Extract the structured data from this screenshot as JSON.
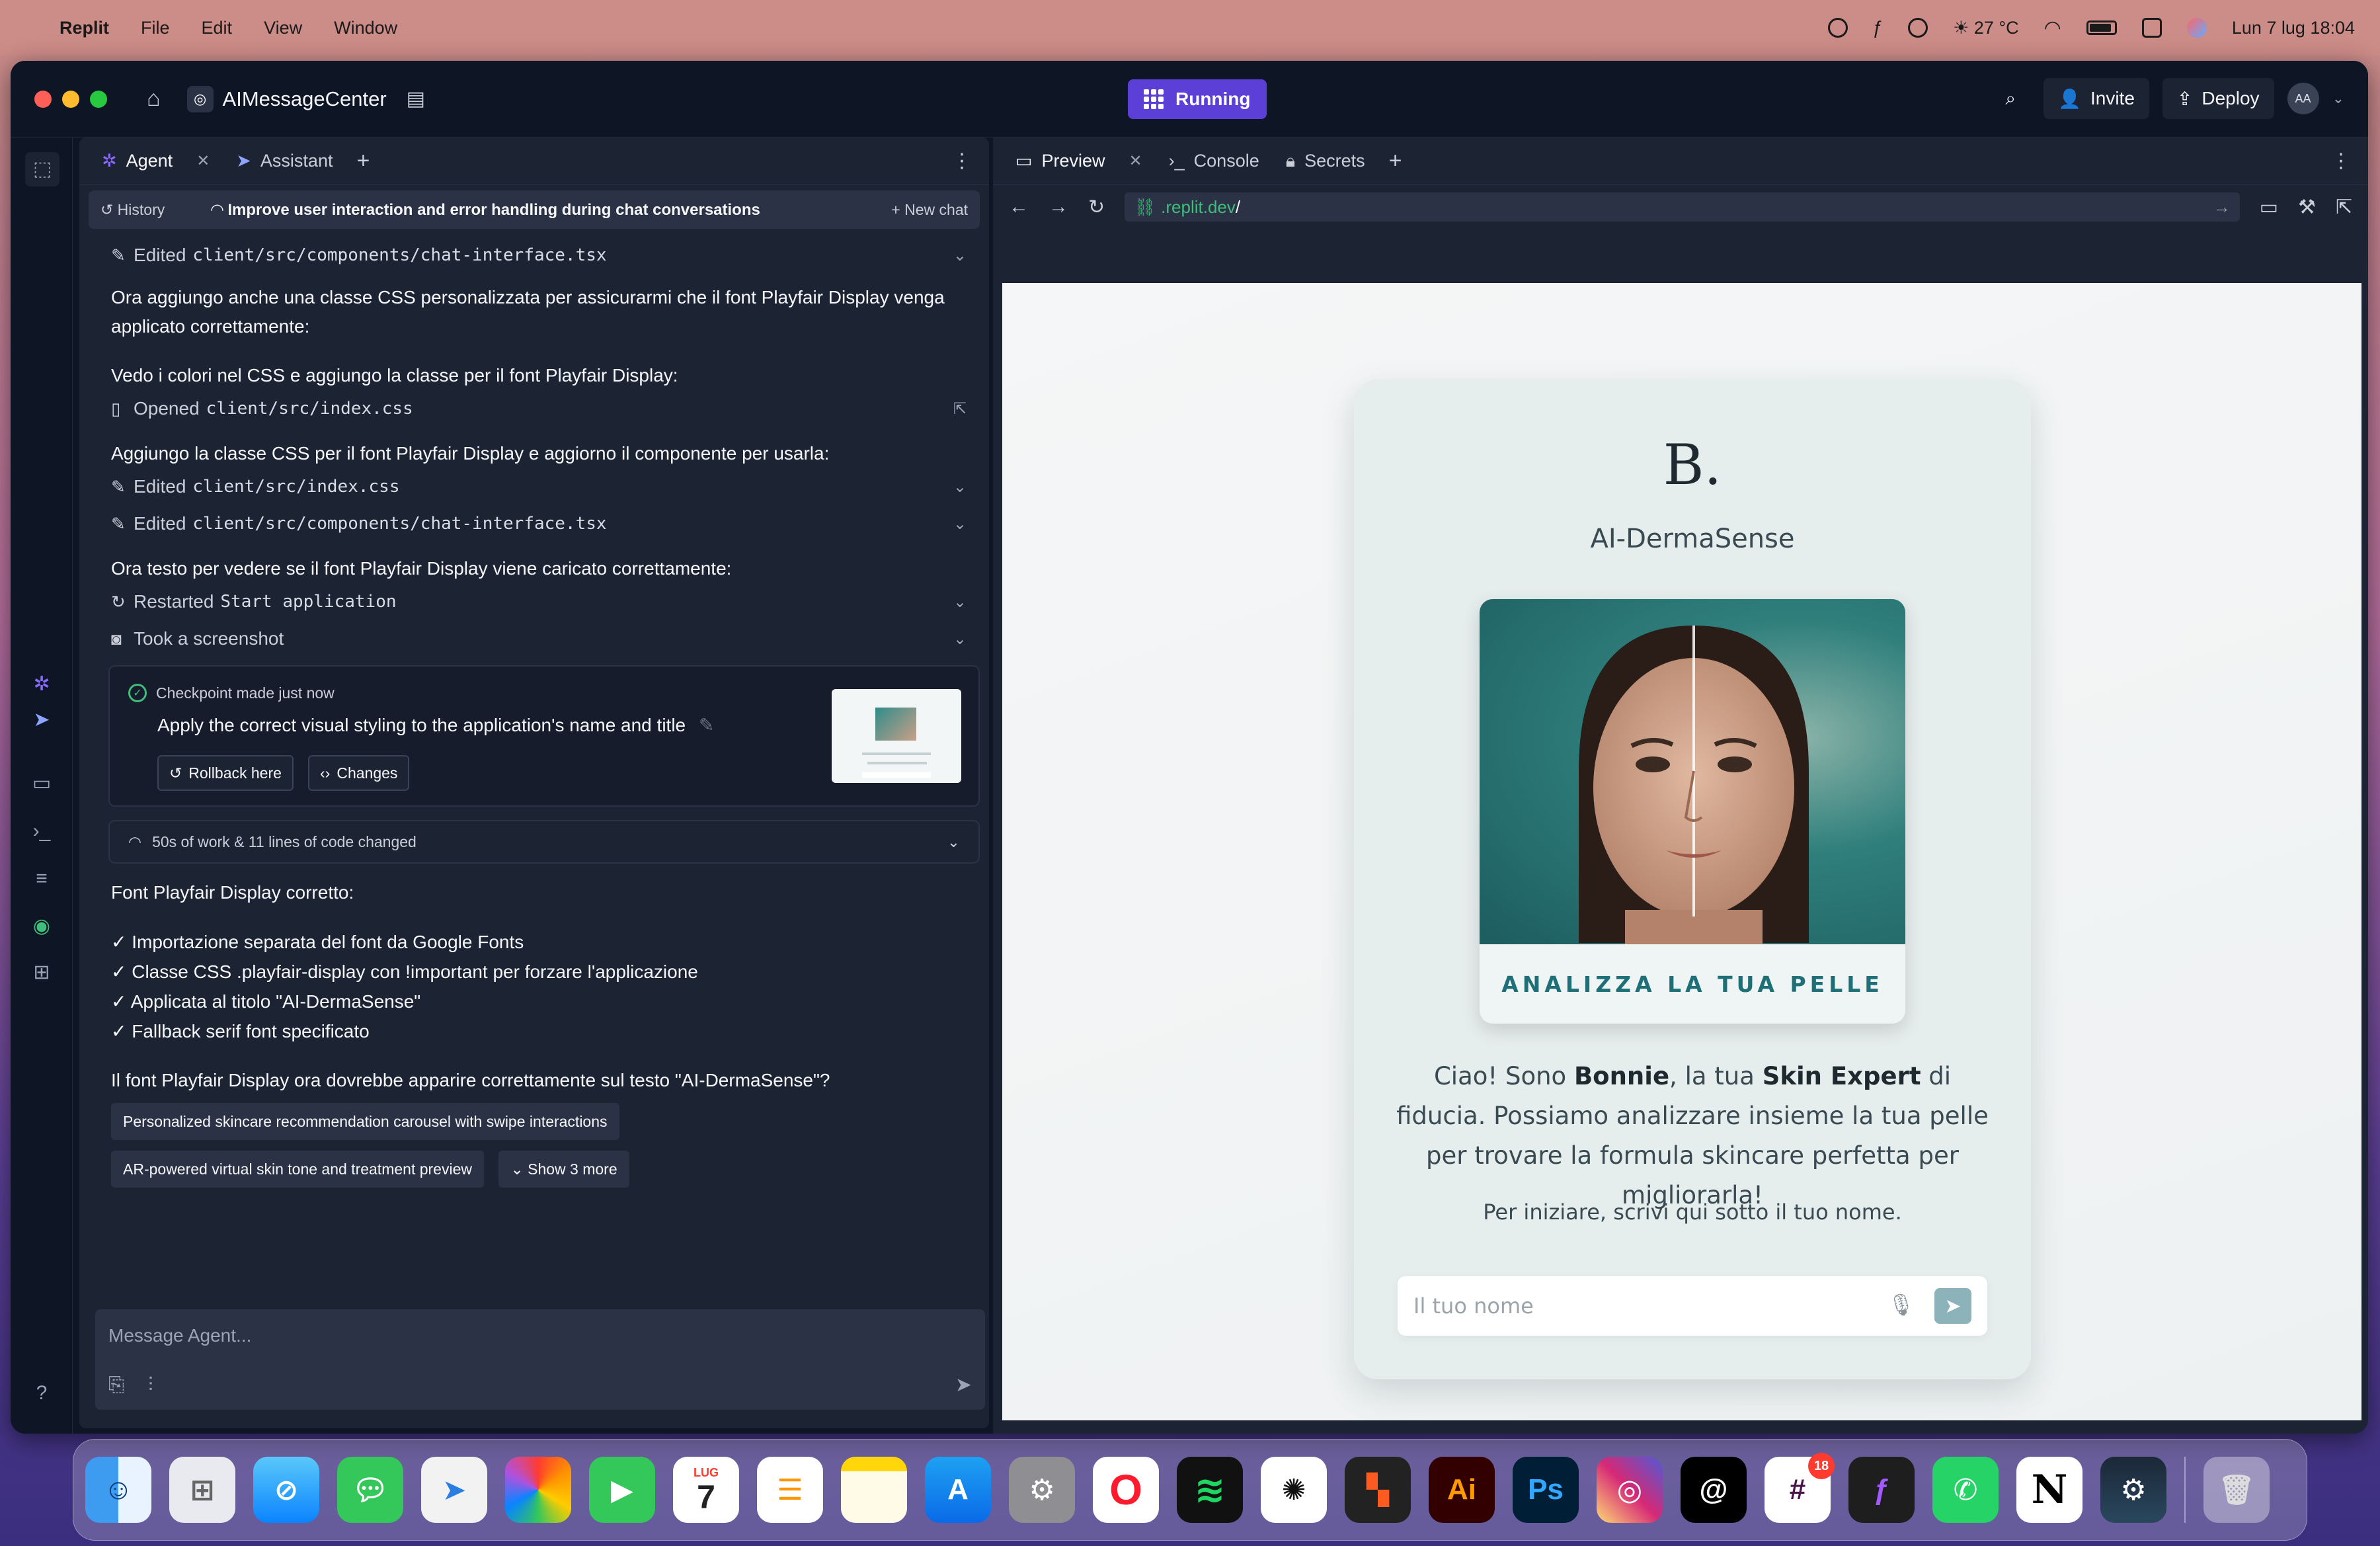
{
  "menubar": {
    "app": "Replit",
    "items": [
      "File",
      "Edit",
      "View",
      "Window"
    ],
    "weather": "27 °C",
    "datetime": "Lun 7 lug  18:04"
  },
  "window": {
    "repl_name": "AIMessageCenter",
    "status": "Running",
    "invite_label": "Invite",
    "deploy_label": "Deploy",
    "avatar_initials": "AA"
  },
  "agent": {
    "tabs": [
      {
        "label": "Agent"
      },
      {
        "label": "Assistant"
      }
    ],
    "history_label": "History",
    "chat_title": "Improve user interaction and error handling during chat conversations",
    "new_chat_label": "New chat",
    "entries": {
      "a1": {
        "verb": "Edited",
        "path": "client/src/components/chat-interface.tsx"
      },
      "m1": "Ora aggiungo anche una classe CSS personalizzata per assicurarmi che il font Playfair Display venga applicato correttamente:",
      "m2": "Vedo i colori nel CSS e aggiungo la classe per il font Playfair Display:",
      "a2": {
        "verb": "Opened",
        "path": "client/src/index.css"
      },
      "m3": "Aggiungo la classe CSS per il font Playfair Display e aggiorno il componente per usarla:",
      "a3": {
        "verb": "Edited",
        "path": "client/src/index.css"
      },
      "a4": {
        "verb": "Edited",
        "path": "client/src/components/chat-interface.tsx"
      },
      "m4": "Ora testo per vedere se il font Playfair Display viene caricato correttamente:",
      "a5": {
        "verb": "Restarted",
        "path": "Start application"
      },
      "a6": {
        "verb": "Took a screenshot"
      }
    },
    "checkpoint": {
      "status": "Checkpoint made just now",
      "title": "Apply the correct visual styling to the application's name and title",
      "rollback_label": "Rollback here",
      "changes_label": "Changes"
    },
    "work_summary": "50s of work & 11 lines of code changed",
    "result_heading": "Font Playfair Display corretto:",
    "checklist": [
      "✓ Importazione separata del font da Google Fonts",
      "✓ Classe CSS .playfair-display con !important per forzare l'applicazione",
      "✓ Applicata al titolo \"AI-DermaSense\"",
      "✓ Fallback serif font specificato"
    ],
    "question": "Il font Playfair Display ora dovrebbe apparire correttamente sul testo \"AI-DermaSense\"?",
    "suggestions": [
      "Personalized skincare recommendation carousel with swipe interactions",
      "AR-powered virtual skin tone and treatment preview"
    ],
    "show_more_label": "Show 3 more",
    "composer_placeholder": "Message Agent..."
  },
  "preview": {
    "tabs": [
      {
        "label": "Preview"
      },
      {
        "label": "Console"
      },
      {
        "label": "Secrets"
      }
    ],
    "url_host": ".replit.dev",
    "url_path": "/"
  },
  "site": {
    "brand_mark": "B.",
    "brand_name": "AI-DermaSense",
    "cta": "ANALIZZA LA TUA PELLE",
    "greeting": {
      "p1": "Ciao! Sono ",
      "name": "Bonnie",
      "p2": ", la tua ",
      "role": "Skin Expert",
      "p3": " di fiducia. Possiamo analizzare insieme la tua pelle per trovare la formula skincare perfetta per migliorarla!"
    },
    "instruction": "Per iniziare, scrivi qui sotto il tuo nome.",
    "name_placeholder": "Il tuo nome"
  },
  "dock": {
    "calendar_month": "LUG",
    "calendar_day": "7",
    "slack_badge": "18",
    "illustrator_label": "Ai",
    "photoshop_label": "Ps",
    "notion_label": "N"
  },
  "colors": {
    "accent": "#5b3fd6",
    "panel_bg": "#1c2333",
    "site_accent": "#1f6f78",
    "success": "#3ebd7b"
  }
}
